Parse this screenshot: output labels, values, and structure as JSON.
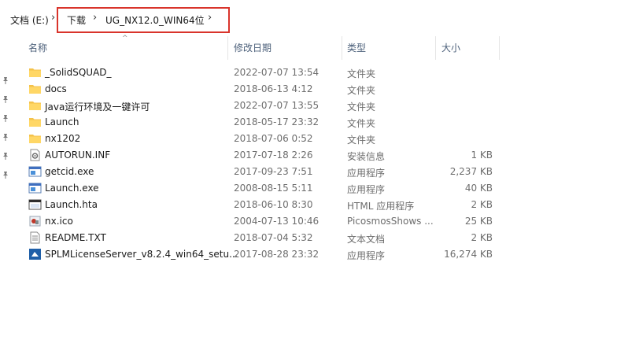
{
  "address": {
    "drive": "文档 (E:)",
    "folder1": "下载",
    "folder2": "UG_NX12.0_WIN64位"
  },
  "columns": {
    "name": "名称",
    "date": "修改日期",
    "type": "类型",
    "size": "大小"
  },
  "files": [
    {
      "name": "_SolidSQUAD_",
      "date": "2022-07-07 13:54",
      "type": "文件夹",
      "size": "",
      "icon": "folder-icon"
    },
    {
      "name": "docs",
      "date": "2018-06-13 4:12",
      "type": "文件夹",
      "size": "",
      "icon": "folder-icon"
    },
    {
      "name": "Java运行环境及一键许可",
      "date": "2022-07-07 13:55",
      "type": "文件夹",
      "size": "",
      "icon": "folder-icon"
    },
    {
      "name": "Launch",
      "date": "2018-05-17 23:32",
      "type": "文件夹",
      "size": "",
      "icon": "folder-icon"
    },
    {
      "name": "nx1202",
      "date": "2018-07-06 0:52",
      "type": "文件夹",
      "size": "",
      "icon": "folder-icon"
    },
    {
      "name": "AUTORUN.INF",
      "date": "2017-07-18 2:26",
      "type": "安装信息",
      "size": "1 KB",
      "icon": "inf-file-icon"
    },
    {
      "name": "getcid.exe",
      "date": "2017-09-23 7:51",
      "type": "应用程序",
      "size": "2,237 KB",
      "icon": "exe-file-icon"
    },
    {
      "name": "Launch.exe",
      "date": "2008-08-15 5:11",
      "type": "应用程序",
      "size": "40 KB",
      "icon": "exe-file-icon"
    },
    {
      "name": "Launch.hta",
      "date": "2018-06-10 8:30",
      "type": "HTML 应用程序",
      "size": "2 KB",
      "icon": "hta-file-icon"
    },
    {
      "name": "nx.ico",
      "date": "2004-07-13 10:46",
      "type": "PicosmosShows ...",
      "size": "25 KB",
      "icon": "ico-file-icon"
    },
    {
      "name": "README.TXT",
      "date": "2018-07-04 5:32",
      "type": "文本文档",
      "size": "2 KB",
      "icon": "text-file-icon"
    },
    {
      "name": "SPLMLicenseServer_v8.2.4_win64_setu...",
      "date": "2017-08-28 23:32",
      "type": "应用程序",
      "size": "16,274 KB",
      "icon": "setup-file-icon"
    }
  ]
}
